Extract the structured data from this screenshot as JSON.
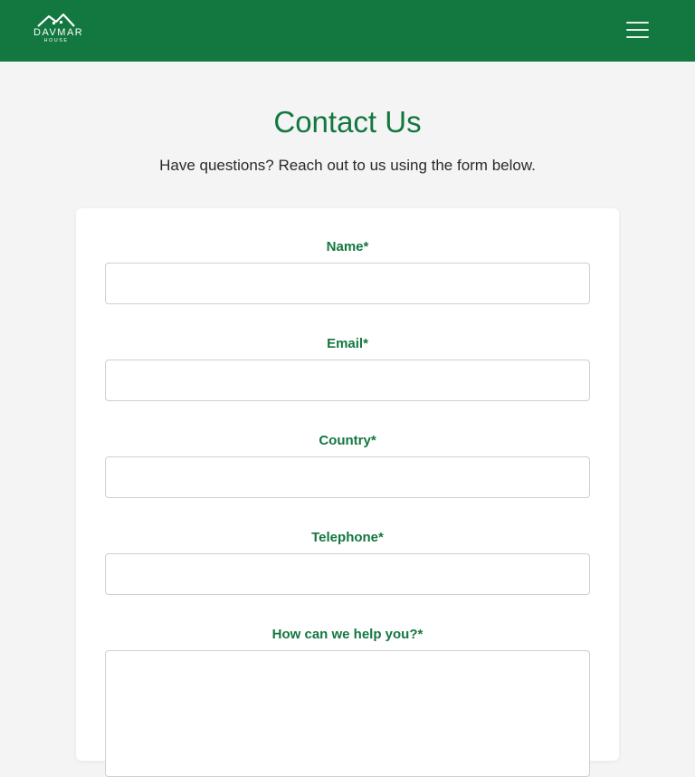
{
  "header": {
    "logo": {
      "name": "DAVMAR",
      "sub": "HOUSE",
      "icon": "house-roof-icon"
    },
    "menu_icon": "hamburger-menu-icon"
  },
  "page": {
    "title": "Contact Us",
    "subtitle": "Have questions? Reach out to us using the form below."
  },
  "form": {
    "fields": [
      {
        "label": "Name*",
        "value": "",
        "placeholder": ""
      },
      {
        "label": "Email*",
        "value": "",
        "placeholder": ""
      },
      {
        "label": "Country*",
        "value": "",
        "placeholder": ""
      },
      {
        "label": "Telephone*",
        "value": "",
        "placeholder": ""
      },
      {
        "label": "How can we help you?*",
        "value": "",
        "placeholder": ""
      }
    ]
  },
  "colors": {
    "brand_green": "#137740",
    "page_background": "#f4f4f4",
    "card_background": "#ffffff"
  }
}
